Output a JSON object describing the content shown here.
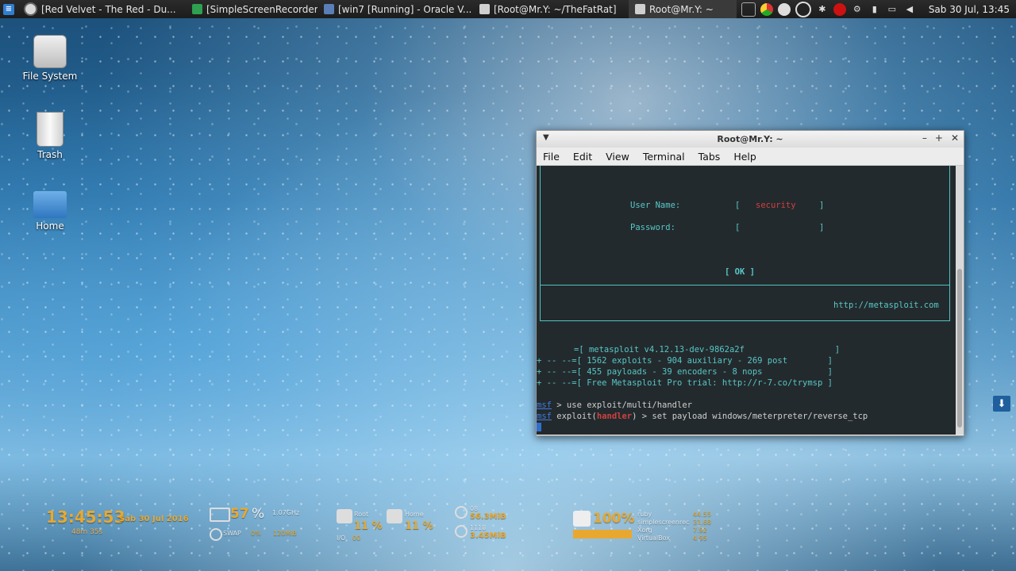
{
  "topbar": {
    "tasks": [
      {
        "label": "[Red Velvet - The Red - Du...",
        "color": "#d9d9d9"
      },
      {
        "label": "[SimpleScreenRecorder]",
        "color": "#2ea04f"
      },
      {
        "label": "[win7 [Running] - Oracle V...",
        "color": "#5a7fb8"
      },
      {
        "label": "[Root@Mr.Y: ~/TheFatRat]",
        "color": "#cfcfcf"
      },
      {
        "label": "Root@Mr.Y: ~",
        "color": "#cfcfcf"
      }
    ],
    "clock": "Sab 30 Jul, 13:45"
  },
  "desktop": {
    "icons": [
      {
        "label": "File System"
      },
      {
        "label": "Trash"
      },
      {
        "label": "Home"
      }
    ]
  },
  "terminal": {
    "title": "Root@Mr.Y: ~",
    "menu": [
      "File",
      "Edit",
      "View",
      "Terminal",
      "Tabs",
      "Help"
    ],
    "login": {
      "username_label": "User Name:",
      "username_value": "security",
      "password_label": "Password:",
      "ok": "[ OK ]",
      "url": "http://metasploit.com"
    },
    "banner": [
      "=[ metasploit v4.12.13-dev-9862a2f                  ]",
      "+ -- --=[ 1562 exploits - 904 auxiliary - 269 post        ]",
      "+ -- --=[ 455 payloads - 39 encoders - 8 nops             ]",
      "+ -- --=[ Free Metasploit Pro trial: http://r-7.co/trymsp ]"
    ],
    "cmd1": {
      "prompt": "msf",
      "text": " > use exploit/multi/handler"
    },
    "cmd2": {
      "prompt": "msf",
      "mid": " exploit(",
      "module": "handler",
      "text": ") > set payload windows/meterpreter/reverse_tcp"
    }
  },
  "conky": {
    "time": "13:45:53",
    "date": "Sab 30 Jul 2016",
    "uptime": "48m 35s",
    "cpu_percent": "57",
    "percent_sign": "%",
    "cpu_freq": "1.07GHz",
    "swap_label": "SWAP",
    "swap_value": "0%",
    "mem_value": "120MiB",
    "root_label": "Root",
    "root_value": "11 %",
    "io_label": "I/O",
    "io_value": "00",
    "home_label": "Home",
    "home_value": "11 %",
    "down_label": "08",
    "down_value": "56.3MiB",
    "up_label": "1118",
    "up_value": "3.45MiB",
    "battery": "100%",
    "processes": [
      {
        "name": "ruby",
        "value": "44.55"
      },
      {
        "name": "simplescreenrec",
        "value": "31.68"
      },
      {
        "name": "Xorg",
        "value": "7.92"
      },
      {
        "name": "VirtualBox",
        "value": "4.95"
      }
    ]
  }
}
